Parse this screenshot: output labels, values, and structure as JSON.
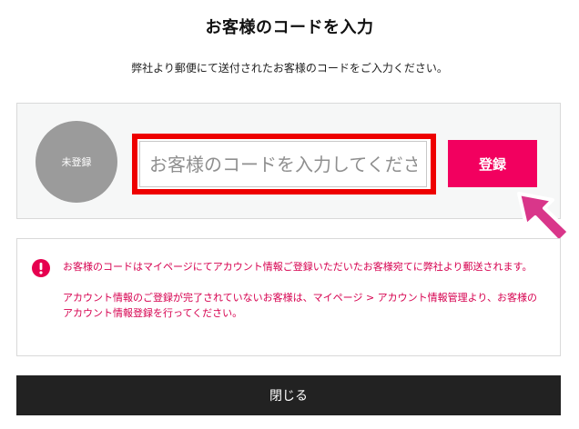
{
  "dialog": {
    "title": "お客様のコードを入力",
    "subtitle": "弊社より郵便にて送付されたお客様のコードをご入力ください。"
  },
  "code_panel": {
    "avatar_label": "未登録",
    "input_placeholder": "お客様のコードを入力してください",
    "input_value": "",
    "register_label": "登録",
    "arrow_icon": "pointer-arrow-icon"
  },
  "notice": {
    "icon": "exclamation-icon",
    "paragraph_1": "お客様のコードはマイページにてアカウント情報ご登録いただいたお客様宛てに弊社より郵送されます。",
    "paragraph_2": "アカウント情報のご登録が完了されていないお客様は、マイページ > アカウント情報管理より、お客様のアカウント情報登録を行ってください。"
  },
  "footer": {
    "close_label": "閉じる"
  },
  "colors": {
    "accent": "#f2005f",
    "highlight_border": "#ee0000",
    "notice_text": "#d6004f",
    "arrow": "#d9368a",
    "avatar": "#9b9b9b",
    "close_button": "#222222"
  }
}
